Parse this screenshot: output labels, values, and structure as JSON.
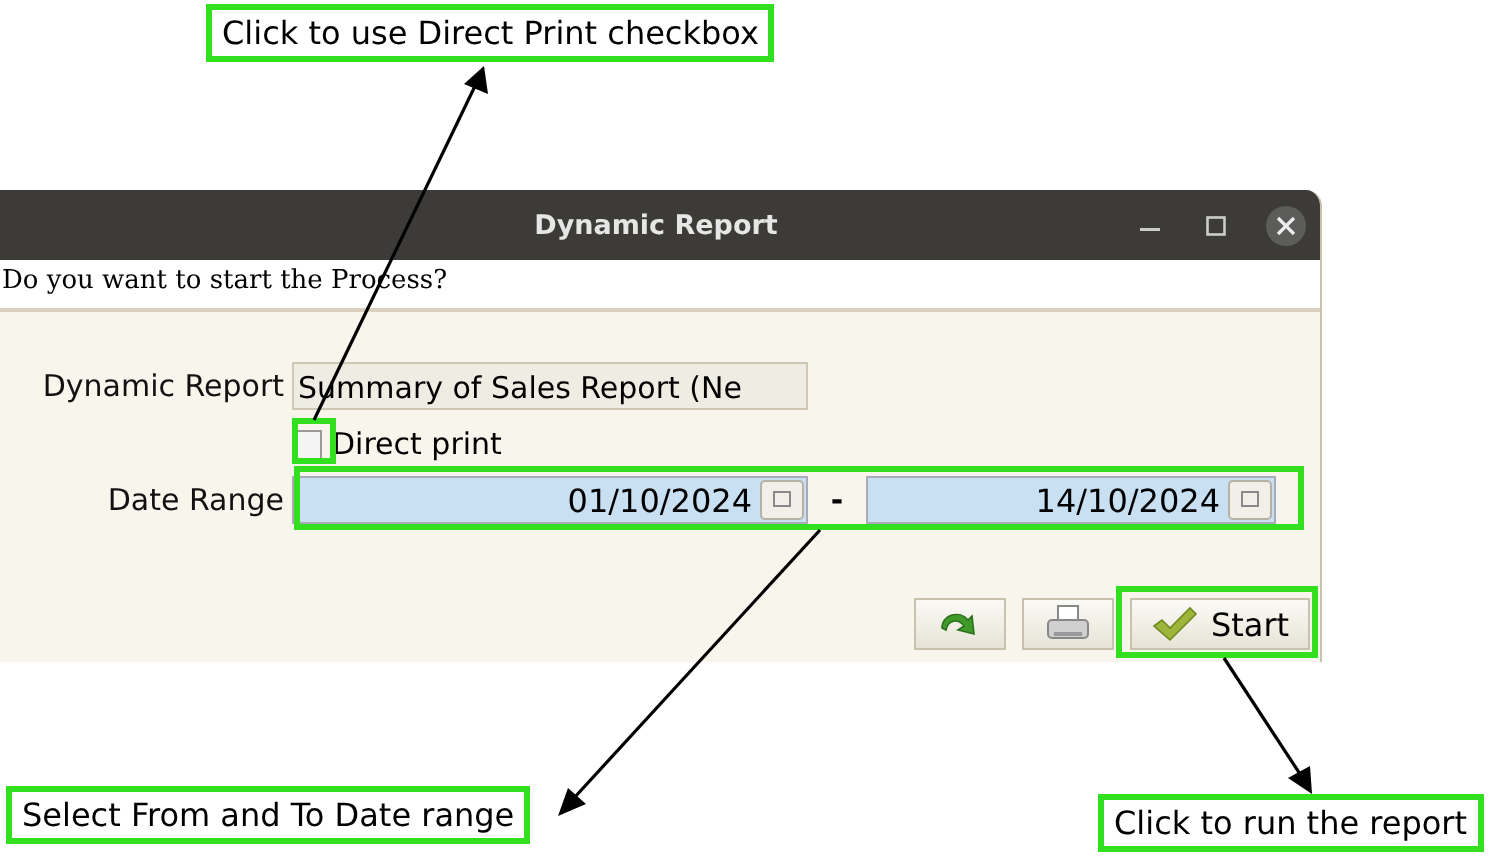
{
  "window": {
    "title": "Dynamic Report",
    "prompt": "Do you want to start the Process?"
  },
  "form": {
    "report_label": "Dynamic Report",
    "report_value": "Summary of Sales Report (Ne",
    "direct_print": {
      "label": "Direct print",
      "checked": false
    },
    "date_label": "Date Range",
    "date_from": "01/10/2024",
    "separator": "-",
    "date_to": "14/10/2024"
  },
  "buttons": [
    {
      "kind": "refresh"
    },
    {
      "kind": "print"
    },
    {
      "kind": "start",
      "label": "Start"
    }
  ],
  "annotations": [
    {
      "text": "Click to use Direct Print checkbox"
    },
    {
      "text": "Select From and To Date range"
    },
    {
      "text": "Click to run the report"
    }
  ]
}
